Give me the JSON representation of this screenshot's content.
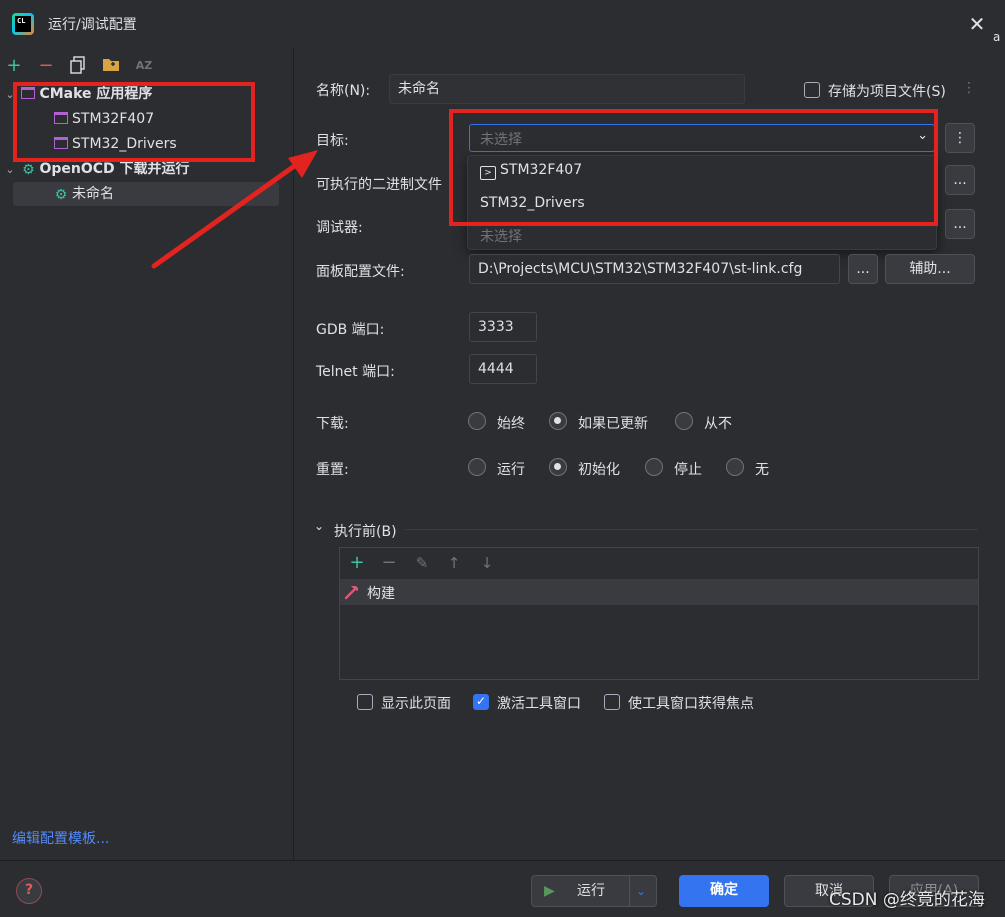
{
  "window": {
    "title": "运行/调试配置",
    "logo_text": "CL",
    "close_glyph": "✕",
    "edge_text": "a"
  },
  "left_toolbar": {
    "add": "+",
    "remove": "−",
    "sort": "AZ"
  },
  "tree": {
    "cmake_group": "CMake 应用程序",
    "cmake_items": [
      "STM32F407",
      "STM32_Drivers"
    ],
    "openocd_group": "OpenOCD 下载并运行",
    "openocd_items": [
      "未命名"
    ]
  },
  "edit_templates_link": "编辑配置模板...",
  "form": {
    "name_label": "名称(N):",
    "name_value": "未命名",
    "store_as_project_label": "存储为项目文件(S)",
    "target_label": "目标:",
    "target_placeholder": "未选择",
    "target_options": [
      "STM32F407",
      "STM32_Drivers"
    ],
    "executable_label": "可执行的二进制文件",
    "debugger_label": "调试器:",
    "debugger_value": "未选择",
    "board_config_label": "面板配置文件:",
    "board_config_value": "D:\\Projects\\MCU\\STM32\\STM32F407\\st-link.cfg",
    "browse_label": "...",
    "assist_label": "辅助...",
    "gdb_port_label": "GDB 端口:",
    "gdb_port_value": "3333",
    "telnet_port_label": "Telnet 端口:",
    "telnet_port_value": "4444",
    "download_label": "下载:",
    "download_options": [
      "始终",
      "如果已更新",
      "从不"
    ],
    "download_selected": "如果已更新",
    "reset_label": "重置:",
    "reset_options": [
      "运行",
      "初始化",
      "停止",
      "无"
    ],
    "reset_selected": "初始化"
  },
  "before_launch": {
    "header": "执行前(B)",
    "tasks": [
      "构建"
    ],
    "show_page_label": "显示此页面",
    "activate_tool_window_label": "激活工具窗口",
    "focus_tool_window_label": "使工具窗口获得焦点",
    "activate_tool_window_checked": true
  },
  "buttons": {
    "run": "运行",
    "ok": "确定",
    "cancel": "取消",
    "apply": "应用(A)"
  },
  "help_glyph": "?",
  "watermark": "CSDN @终竟的花海",
  "colors": {
    "background": "#2b2d30",
    "accent": "#3574f0",
    "annotation": "#e3231f",
    "cmake_icon": "#b55fd6",
    "openocd_icon": "#3fc1a5",
    "add_green": "#3fc1a5",
    "remove_red": "#db5c5c",
    "link": "#548af7"
  }
}
